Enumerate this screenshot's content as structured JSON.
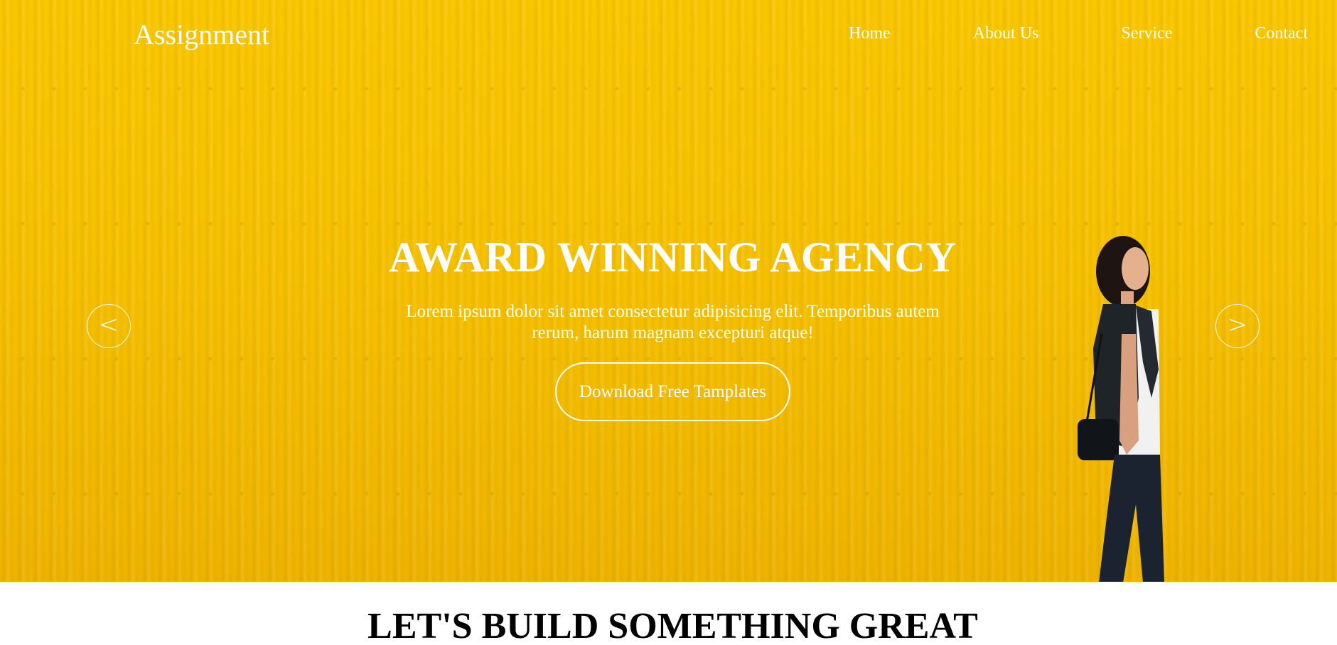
{
  "header": {
    "logo": "Assignment",
    "nav": [
      "Home",
      "About Us",
      "Service",
      "Contact"
    ]
  },
  "hero": {
    "headline": "AWARD WINNING AGENCY",
    "subtext": "Lorem ipsum dolor sit amet consectetur adipisicing elit. Temporibus autem rerum, harum magnam excepturi atque!",
    "cta_label": "Download Free Tamplates",
    "prev_arrow": "<",
    "next_arrow": ">",
    "background_color": "#fcc800"
  },
  "section": {
    "title": "LET'S BUILD SOMETHING GREAT"
  }
}
